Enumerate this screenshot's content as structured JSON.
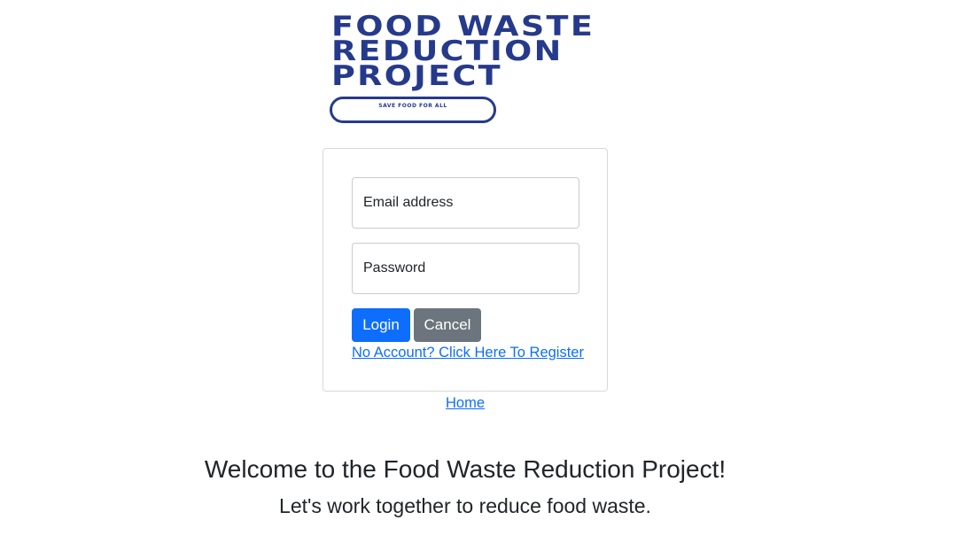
{
  "logo": {
    "title_lines": [
      "FOOD WASTE",
      "REDUCTION",
      "PROJECT"
    ],
    "tagline": "SAVE FOOD FOR ALL",
    "color": "#263a8c"
  },
  "login_form": {
    "email_placeholder": "Email address",
    "email_value": "",
    "password_placeholder": "Password",
    "password_value": "",
    "login_label": "Login",
    "cancel_label": "Cancel",
    "register_link": "No Account? Click Here To Register"
  },
  "nav": {
    "home_link": "Home"
  },
  "main": {
    "welcome_heading": "Welcome to the Food Waste Reduction Project!",
    "subheading": "Let's work together to reduce food waste."
  },
  "colors": {
    "primary": "#0d6efd",
    "secondary": "#6c757d",
    "text": "#212529"
  }
}
